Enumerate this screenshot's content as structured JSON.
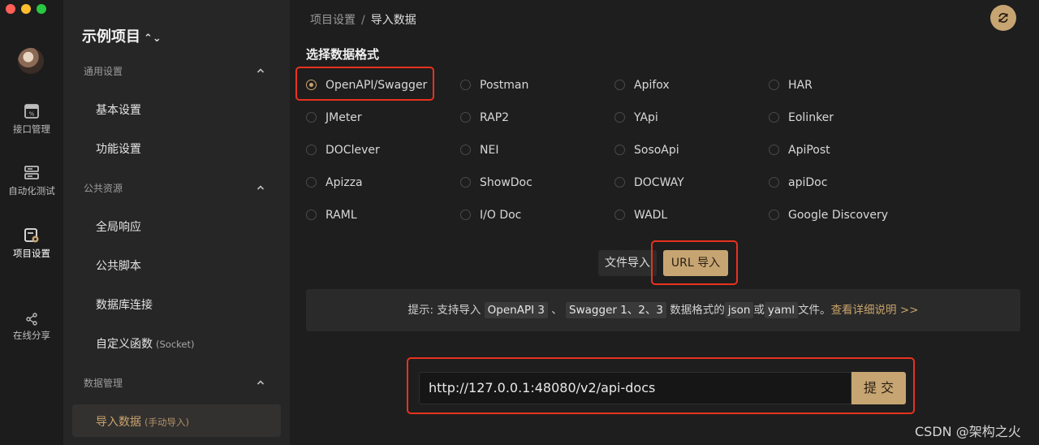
{
  "window": {
    "traffic_lights": [
      "close",
      "minimize",
      "zoom"
    ]
  },
  "rail": {
    "items": [
      {
        "label": "接口管理",
        "icon": "api-box-icon"
      },
      {
        "label": "自动化测试",
        "icon": "server-stack-icon"
      },
      {
        "label": "项目设置",
        "icon": "project-settings-icon",
        "active": true
      },
      {
        "label": "在线分享",
        "icon": "share-icon"
      }
    ]
  },
  "sidebar": {
    "project_name": "示例项目",
    "project_chevron": "⌃⌄",
    "groups": [
      {
        "title": "通用设置",
        "items": [
          "基本设置",
          "功能设置"
        ]
      },
      {
        "title": "公共资源",
        "items": [
          "全局响应",
          "公共脚本",
          "数据库连接"
        ],
        "custom_function": {
          "label": "自定义函数",
          "sub": "(Socket)"
        }
      },
      {
        "title": "数据管理",
        "active_item": {
          "label": "导入数据",
          "sub": "(手动导入)"
        }
      }
    ]
  },
  "breadcrumb": {
    "parent": "项目设置",
    "separator": "/",
    "current": "导入数据"
  },
  "section_title": "选择数据格式",
  "formats": {
    "selected": "OpenAPI/Swagger",
    "rows": [
      [
        "OpenAPI/Swagger",
        "Postman",
        "Apifox",
        "HAR"
      ],
      [
        "JMeter",
        "RAP2",
        "YApi",
        "Eolinker"
      ],
      [
        "DOClever",
        "NEI",
        "SosoApi",
        "ApiPost"
      ],
      [
        "Apizza",
        "ShowDoc",
        "DOCWAY",
        "apiDoc"
      ],
      [
        "RAML",
        "I/O Doc",
        "WADL",
        "Google Discovery"
      ]
    ]
  },
  "import_mode": {
    "file_label": "文件导入",
    "url_label": "URL 导入",
    "selected": "URL 导入"
  },
  "tip": {
    "prefix": "提示: 支持导入",
    "code1": "OpenAPI 3",
    "mid1": "、",
    "code2": "Swagger 1、2、3",
    "mid2": "数据格式的",
    "code3": "json",
    "mid3": "或",
    "code4": "yaml",
    "suffix": "文件。",
    "link": "查看详细说明 >>"
  },
  "url_form": {
    "value": "http://127.0.0.1:48080/v2/api-docs",
    "submit_label": "提 交"
  },
  "watermark": "CSDN @架构之火",
  "colors": {
    "accent": "#c7a572",
    "highlight": "#e8321e",
    "background": "#1e1e1e"
  }
}
